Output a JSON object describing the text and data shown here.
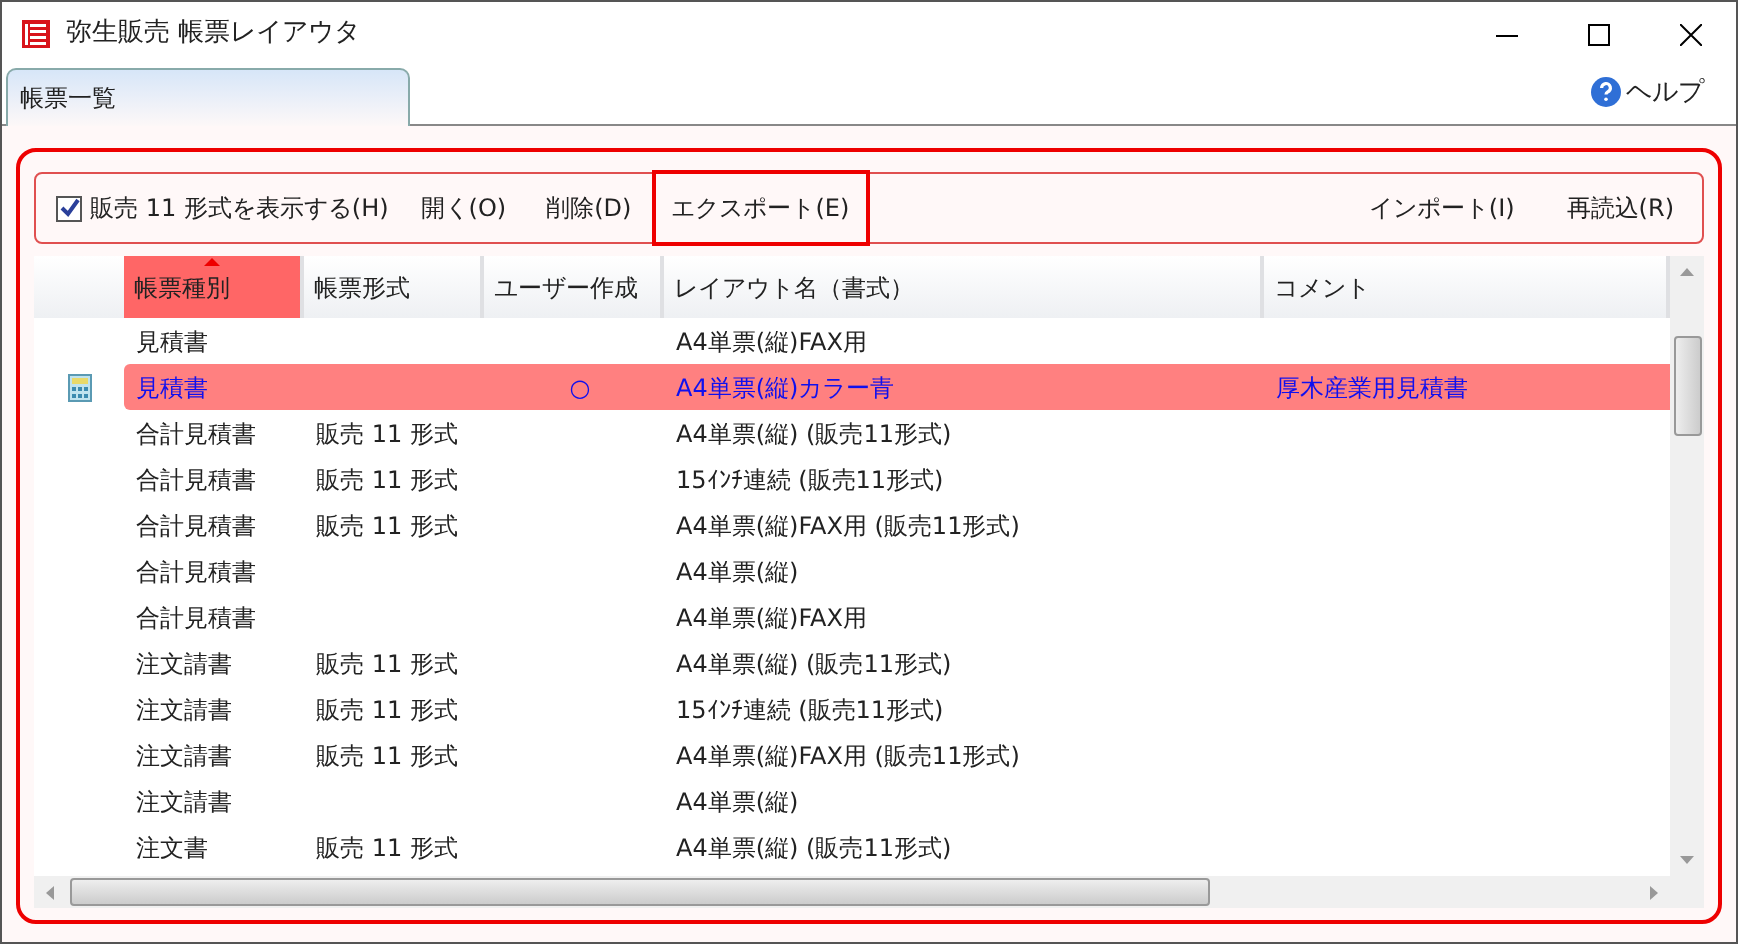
{
  "window": {
    "title": "弥生販売 帳票レイアウタ"
  },
  "tabs": [
    {
      "label": "帳票一覧",
      "selected": true
    }
  ],
  "help": {
    "label": "ヘルプ"
  },
  "toolbar": {
    "left": [
      {
        "kind": "checkbox",
        "label": "販売 11 形式を表示する(H)",
        "checked": true,
        "highlighted": false
      },
      {
        "kind": "button",
        "label": "開く(O)",
        "highlighted": false
      },
      {
        "kind": "button",
        "label": "削除(D)",
        "highlighted": false
      },
      {
        "kind": "button",
        "label": "エクスポート(E)",
        "highlighted": true
      }
    ],
    "right": [
      {
        "kind": "button",
        "label": "インポート(I)",
        "highlighted": false
      },
      {
        "kind": "button",
        "label": "再読込(R)",
        "highlighted": false
      }
    ]
  },
  "table": {
    "columns": [
      {
        "label": "帳票種別",
        "sorted": true
      },
      {
        "label": "帳票形式",
        "sorted": false
      },
      {
        "label": "ユーザー作成",
        "sorted": false
      },
      {
        "label": "レイアウト名（書式）",
        "sorted": false
      },
      {
        "label": "コメント",
        "sorted": false
      }
    ],
    "rows": [
      {
        "selected": false,
        "cells": [
          "見積書",
          "",
          "",
          "A4単票(縦)FAX用",
          ""
        ]
      },
      {
        "selected": true,
        "cells": [
          "見積書",
          "",
          "○",
          "A4単票(縦)カラー青",
          "厚木産業用見積書"
        ]
      },
      {
        "selected": false,
        "cells": [
          "合計見積書",
          "販売 11 形式",
          "",
          "A4単票(縦) (販売11形式)",
          ""
        ]
      },
      {
        "selected": false,
        "cells": [
          "合計見積書",
          "販売 11 形式",
          "",
          "15ｲﾝﾁ連続 (販売11形式)",
          ""
        ]
      },
      {
        "selected": false,
        "cells": [
          "合計見積書",
          "販売 11 形式",
          "",
          "A4単票(縦)FAX用 (販売11形式)",
          ""
        ]
      },
      {
        "selected": false,
        "cells": [
          "合計見積書",
          "",
          "",
          "A4単票(縦)",
          ""
        ]
      },
      {
        "selected": false,
        "cells": [
          "合計見積書",
          "",
          "",
          "A4単票(縦)FAX用",
          ""
        ]
      },
      {
        "selected": false,
        "cells": [
          "注文請書",
          "販売 11 形式",
          "",
          "A4単票(縦) (販売11形式)",
          ""
        ]
      },
      {
        "selected": false,
        "cells": [
          "注文請書",
          "販売 11 形式",
          "",
          "15ｲﾝﾁ連続 (販売11形式)",
          ""
        ]
      },
      {
        "selected": false,
        "cells": [
          "注文請書",
          "販売 11 形式",
          "",
          "A4単票(縦)FAX用 (販売11形式)",
          ""
        ]
      },
      {
        "selected": false,
        "cells": [
          "注文請書",
          "",
          "",
          "A4単票(縦)",
          ""
        ]
      },
      {
        "selected": false,
        "cells": [
          "注文書",
          "販売 11 形式",
          "",
          "A4単票(縦) (販売11形式)",
          ""
        ]
      }
    ]
  }
}
